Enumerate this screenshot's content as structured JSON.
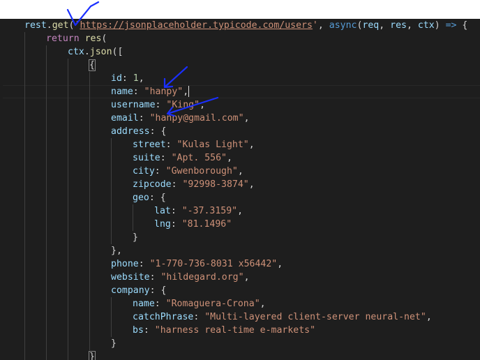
{
  "code": {
    "rest": "rest",
    "get": "get",
    "quote": "'",
    "url": "https://jsonplaceholder.typicode.com/users",
    "async": "async",
    "req": "req",
    "res": "res",
    "ctx": "ctx",
    "arrow": "=>",
    "return": "return",
    "json": "json",
    "k_id": "id",
    "v_id": "1",
    "k_name": "name",
    "v_name": "\"hanpy\"",
    "k_username": "username",
    "v_username": "\"King\"",
    "k_email": "email",
    "v_email": "\"hanpy@gmail.com\"",
    "k_address": "address",
    "k_street": "street",
    "v_street": "\"Kulas Light\"",
    "k_suite": "suite",
    "v_suite": "\"Apt. 556\"",
    "k_city": "city",
    "v_city": "\"Gwenborough\"",
    "k_zipcode": "zipcode",
    "v_zipcode": "\"92998-3874\"",
    "k_geo": "geo",
    "k_lat": "lat",
    "v_lat": "\"-37.3159\"",
    "k_lng": "lng",
    "v_lng": "\"81.1496\"",
    "k_phone": "phone",
    "v_phone": "\"1-770-736-8031 x56442\"",
    "k_website": "website",
    "v_website": "\"hildegard.org\"",
    "k_company": "company",
    "k_cname": "name",
    "v_cname": "\"Romaguera-Crona\"",
    "k_catch": "catchPhrase",
    "v_catch": "\"Multi-layered client-server neural-net\"",
    "k_bs": "bs",
    "v_bs": "\"harness real-time e-markets\""
  },
  "colors": {
    "background": "#1e1e1e",
    "keyword": "#569cd6",
    "control": "#c586c0",
    "function": "#dcdcaa",
    "property": "#9cdcfe",
    "string": "#ce9178",
    "number": "#b5cea8",
    "annotation_ink": "#1a2fff"
  }
}
